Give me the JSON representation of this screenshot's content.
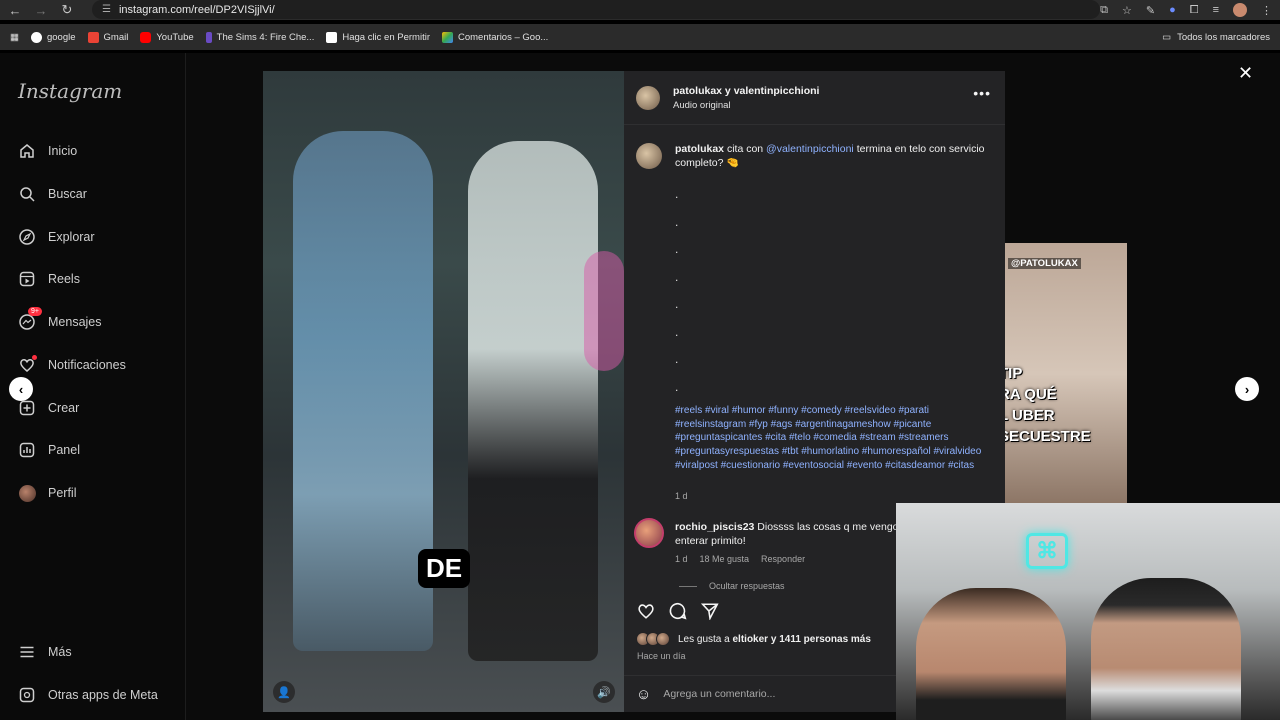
{
  "browser": {
    "url": "instagram.com/reel/DP2VISjjlVi/",
    "bookmarks": [
      "google",
      "Gmail",
      "YouTube",
      "The Sims 4: Fire Che...",
      "Haga clic en Permitir",
      "Comentarios – Goo..."
    ],
    "bookmarks_right": "Todos los marcadores"
  },
  "sidebar": {
    "logo": "Instagram",
    "items": [
      {
        "label": "Inicio",
        "icon": "home-icon"
      },
      {
        "label": "Buscar",
        "icon": "search-icon"
      },
      {
        "label": "Explorar",
        "icon": "compass-icon"
      },
      {
        "label": "Reels",
        "icon": "reels-icon"
      },
      {
        "label": "Mensajes",
        "icon": "messenger-icon",
        "badge": "9+"
      },
      {
        "label": "Notificaciones",
        "icon": "heart-icon"
      },
      {
        "label": "Crear",
        "icon": "plus-icon"
      },
      {
        "label": "Panel",
        "icon": "chart-icon"
      },
      {
        "label": "Perfil",
        "icon": "profile-avatar"
      }
    ],
    "bottom": [
      {
        "label": "Más",
        "icon": "menu-icon"
      },
      {
        "label": "Otras apps de Meta",
        "icon": "meta-icon"
      }
    ]
  },
  "video": {
    "caption_word": "DE"
  },
  "post": {
    "authors": "patolukax y valentinpicchioni",
    "audio": "Audio original",
    "caption_user": "patolukax",
    "caption_pre": "cita con",
    "caption_mention": "@valentinpicchioni",
    "caption_post": "termina en telo con servicio completo? 🤏",
    "dots": [
      ".",
      ".",
      ".",
      ".",
      ".",
      ".",
      ".",
      "."
    ],
    "hashtags": "#reels #viral #humor #funny #comedy #reelsvideo #parati #reelsinstagram #fyp #ags #argentinagameshow #picante #preguntaspicantes #cita #telo #comedia #stream #streamers #preguntasyrespuestas #tbt #humorlatino #humorespañol #viralvideo #viralpost #cuestionario #eventosocial #evento #citasdeamor #citas",
    "time": "1 d"
  },
  "comment": {
    "user": "rochio_piscis23",
    "text": "Diossss las cosas q me vengo a enterar primito!",
    "time": "1 d",
    "likes": "18 Me gusta",
    "reply": "Responder",
    "hide_replies": "Ocultar respuestas"
  },
  "footer": {
    "likes_pre": "Les gusta a",
    "likes_user": "eltioker",
    "likes_post": "y 1411 personas más",
    "time": "Hace un día",
    "comment_placeholder": "Agrega un comentario..."
  },
  "next_preview": {
    "tag": "@PATOLUKAX",
    "text": "TIP\nRA QUÉ\nL UBER\nSECUESTRE"
  }
}
